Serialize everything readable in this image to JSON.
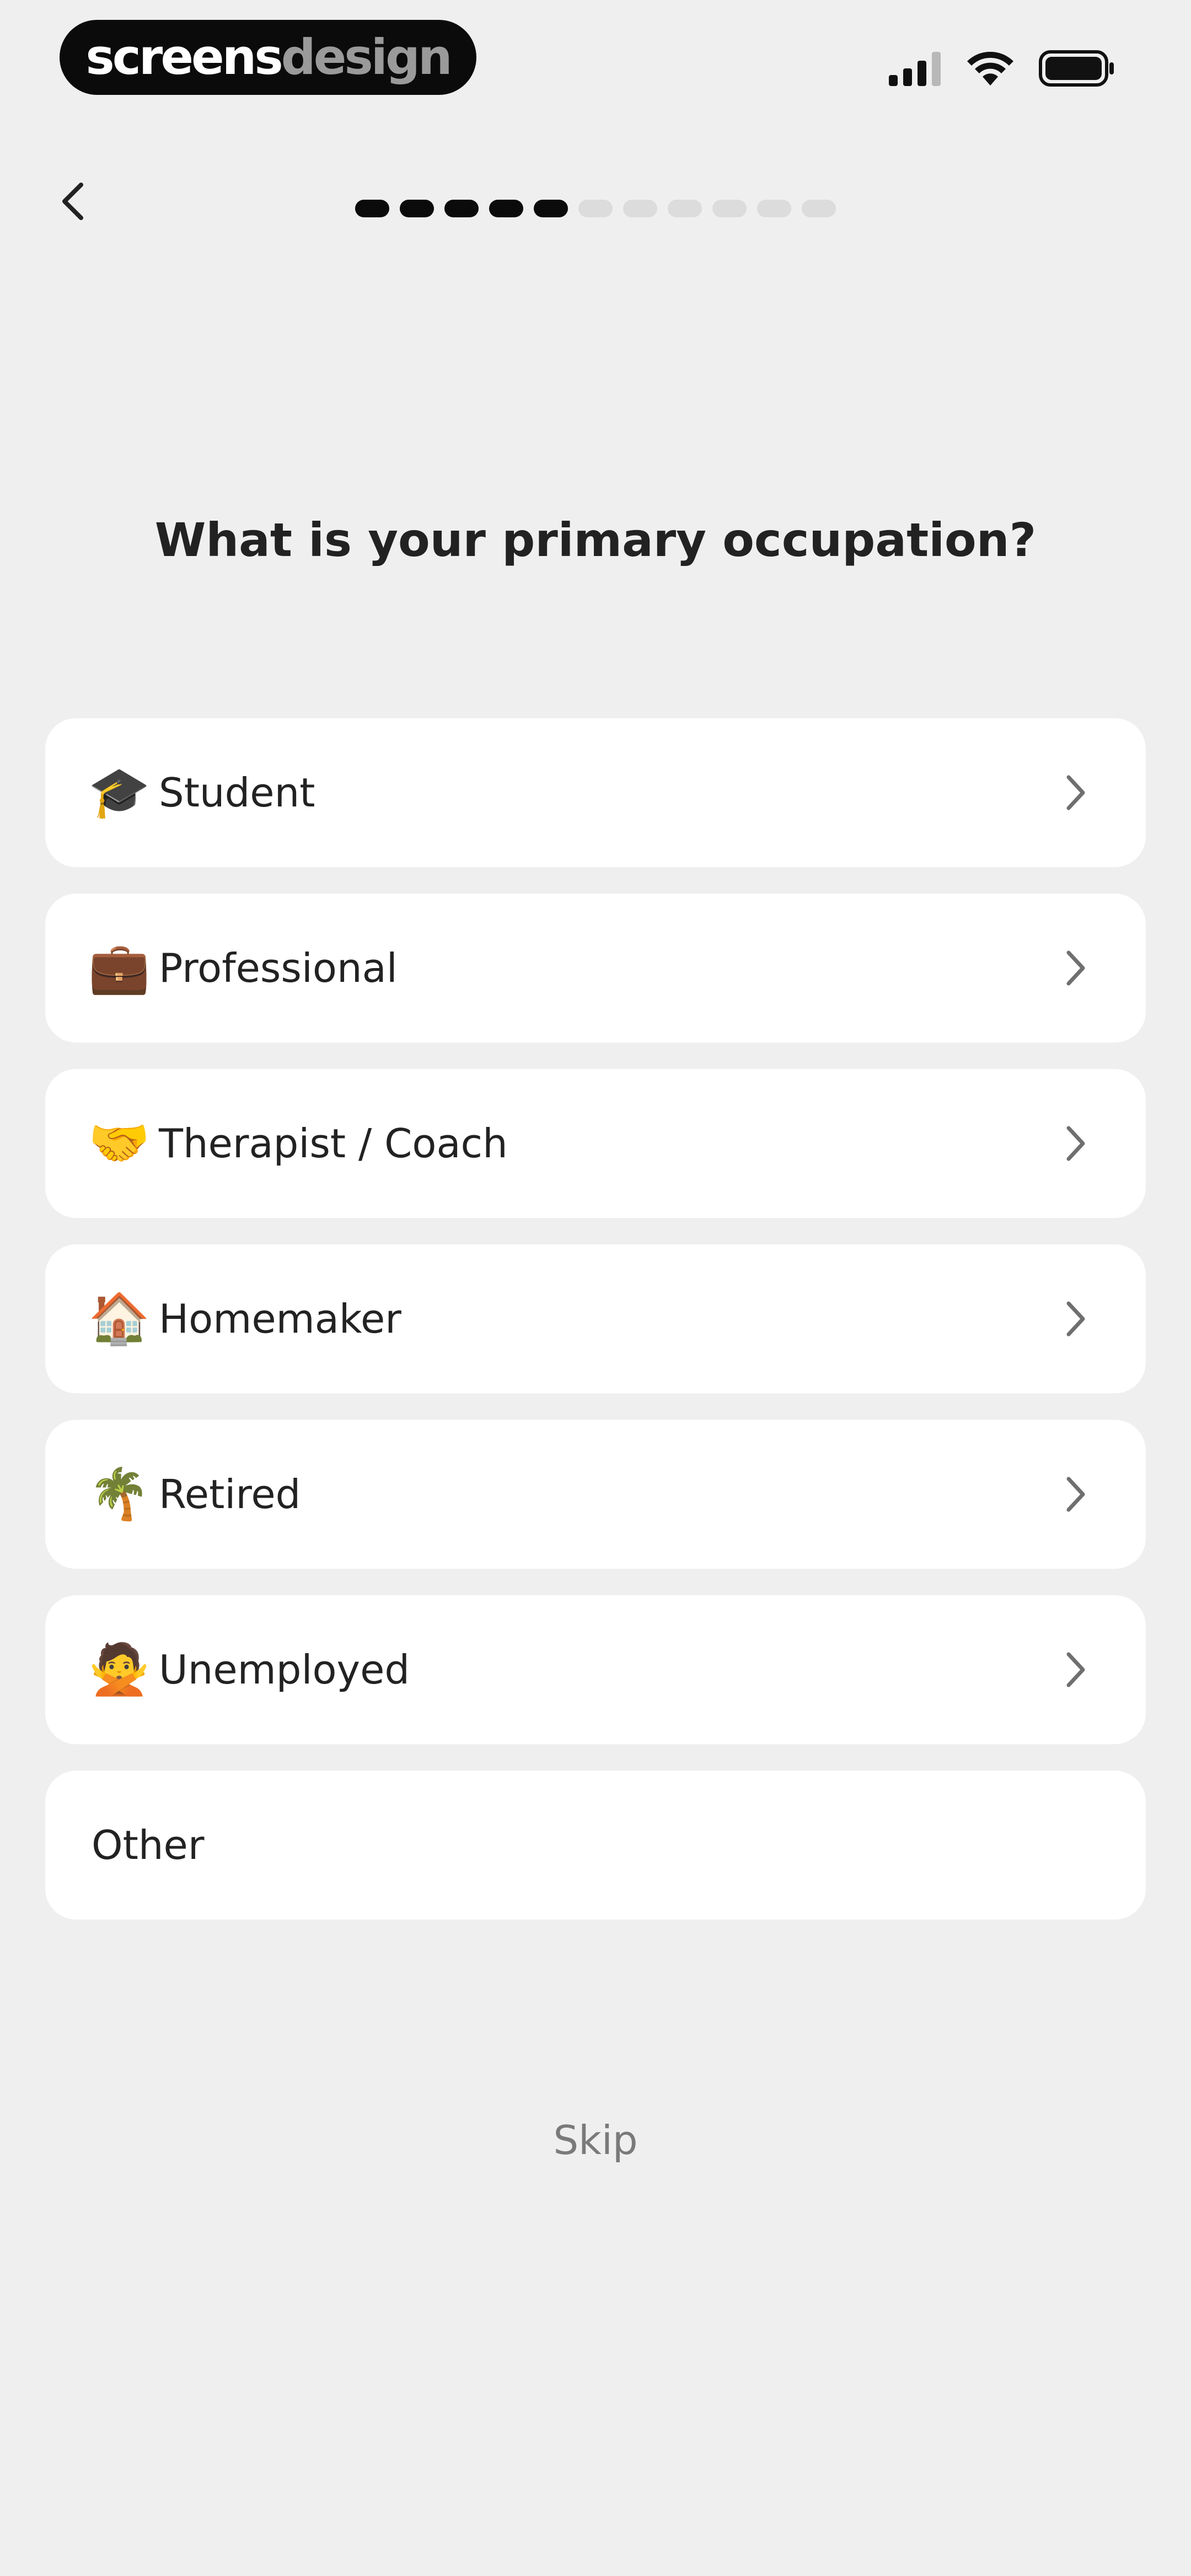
{
  "brand": {
    "part1": "screens",
    "part2": "design"
  },
  "nav": {
    "back_icon": "chevron-left-icon"
  },
  "progress": {
    "total_steps": 11,
    "completed_steps": 5
  },
  "question": "What is your primary occupation?",
  "options": [
    {
      "emoji": "🎓",
      "icon": "graduation-cap-icon",
      "label": "Student"
    },
    {
      "emoji": "💼",
      "icon": "briefcase-icon",
      "label": "Professional"
    },
    {
      "emoji": "🤝",
      "icon": "handshake-icon",
      "label": "Therapist / Coach"
    },
    {
      "emoji": "🏠",
      "icon": "house-icon",
      "label": "Homemaker"
    },
    {
      "emoji": "🌴",
      "icon": "palm-tree-icon",
      "label": "Retired"
    },
    {
      "emoji": "🙅",
      "icon": "person-gesturing-no-icon",
      "label": "Unemployed"
    }
  ],
  "other": {
    "label": "Other"
  },
  "skip": {
    "label": "Skip"
  },
  "colors": {
    "background": "#efefef",
    "card": "#ffffff",
    "progress_active": "#0b0b0b",
    "progress_inactive": "#dcdcdc",
    "muted_text": "#7a7a7a"
  }
}
